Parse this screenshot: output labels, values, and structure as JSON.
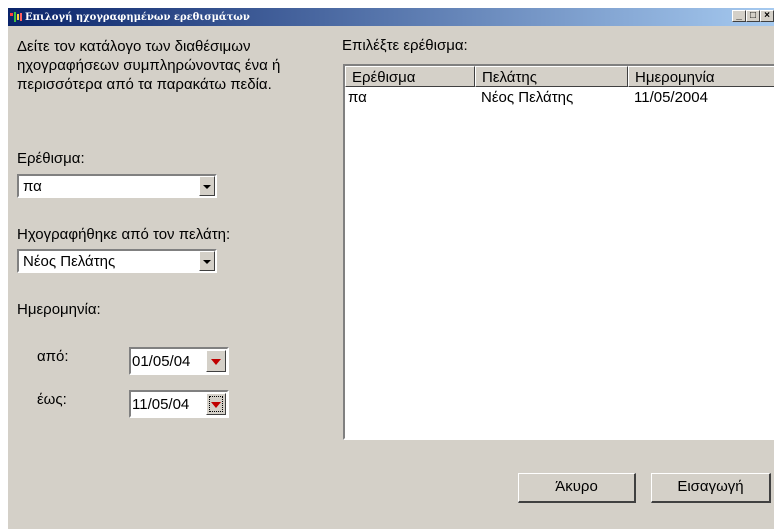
{
  "window": {
    "title": "Επιλογή ηχογραφημένων ερεθισμάτων",
    "minimize_label": "_",
    "maximize_label": "□",
    "close_label": "×"
  },
  "left": {
    "description": "Δείτε τον κατάλογο των διαθέσιμων ηχογραφήσεων συμπληρώνοντας ένα ή περισσότερα από τα παρακάτω πεδία.",
    "stimulus_label": "Ερέθισμα:",
    "stimulus_value": "πα",
    "client_label": "Ηχογραφήθηκε από τον πελάτη:",
    "client_value": "Νέος Πελάτης",
    "date_label": "Ημερομηνία:",
    "from_label": "από:",
    "from_value": "01/05/04",
    "to_label": "έως:",
    "to_value": "11/05/04"
  },
  "right": {
    "select_label": "Επιλέξτε ερέθισμα:",
    "columns": [
      "Ερέθισμα",
      "Πελάτης",
      "Ημερομηνία"
    ],
    "rows": [
      [
        "πα",
        "Νέος Πελάτης",
        "11/05/2004"
      ]
    ]
  },
  "buttons": {
    "cancel": "Άκυρο",
    "insert": "Εισαγωγή"
  },
  "colors": {
    "window_bg": "#d4d0c8",
    "titlebar_start": "#0a246a",
    "titlebar_end": "#a6caf0",
    "date_arrow": "#c00000"
  }
}
